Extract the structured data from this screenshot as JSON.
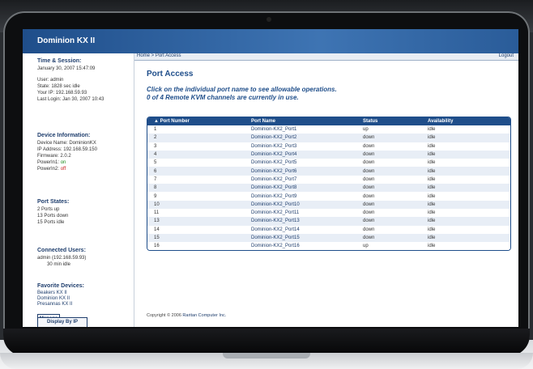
{
  "app": {
    "title": "Dominion KX II",
    "breadcrumb": "Home > Port Access",
    "logout_label": "Logout"
  },
  "sidebar": {
    "time_session": {
      "title": "Time & Session:",
      "datetime": "January 30, 2007 15:47:09",
      "user": "User: admin",
      "state": "State: 1828 sec idle",
      "your_ip": "Your IP: 192.168.59.93",
      "last_login": "Last Login: Jan 30, 2007 10:43"
    },
    "device_info": {
      "title": "Device Information:",
      "device_name": "Device Name: DominionKX",
      "ip_address": "IP Address: 192.168.59.150",
      "firmware": "Firmware: 2.0.2",
      "power1_label": "PowerIn1:",
      "power1_value": "on",
      "power2_label": "PowerIn2:",
      "power2_value": "off"
    },
    "port_states": {
      "title": "Port States:",
      "up": "2 Ports up",
      "down": "13 Ports down",
      "idle": "15 Ports idle"
    },
    "connected_users": {
      "title": "Connected Users:",
      "user": "admin (192.168.59.93)",
      "idle": "30 min idle"
    },
    "favorite_devices": {
      "title": "Favorite Devices:",
      "items": [
        "Beakers KX II",
        "Dominion KX II",
        "Presannas KX II"
      ],
      "manage_label": "Manage",
      "display_label": "Display By IP"
    }
  },
  "main": {
    "title": "Port Access",
    "instruction_1": "Click on the individual port name to see allowable operations.",
    "instruction_2": "0 of 4 Remote KVM channels are currently in use.",
    "columns": [
      "▲ Port Number",
      "Port Name",
      "Status",
      "Availability"
    ],
    "rows": [
      {
        "num": "1",
        "name": "Dominion-KX2_Port1",
        "status": "up",
        "avail": "idle"
      },
      {
        "num": "2",
        "name": "Dominion-KX2_Port2",
        "status": "down",
        "avail": "idle"
      },
      {
        "num": "3",
        "name": "Dominion-KX2_Port3",
        "status": "down",
        "avail": "idle"
      },
      {
        "num": "4",
        "name": "Dominion-KX2_Port4",
        "status": "down",
        "avail": "idle"
      },
      {
        "num": "5",
        "name": "Dominion-KX2_Port5",
        "status": "down",
        "avail": "idle"
      },
      {
        "num": "6",
        "name": "Dominion-KX2_Port6",
        "status": "down",
        "avail": "idle"
      },
      {
        "num": "7",
        "name": "Dominion-KX2_Port7",
        "status": "down",
        "avail": "idle"
      },
      {
        "num": "8",
        "name": "Dominion-KX2_Port8",
        "status": "down",
        "avail": "idle"
      },
      {
        "num": "9",
        "name": "Dominion-KX2_Port9",
        "status": "down",
        "avail": "idle"
      },
      {
        "num": "10",
        "name": "Dominion-KX2_Port10",
        "status": "down",
        "avail": "idle"
      },
      {
        "num": "11",
        "name": "Dominion-KX2_Port11",
        "status": "down",
        "avail": "idle"
      },
      {
        "num": "13",
        "name": "Dominion-KX2_Port13",
        "status": "down",
        "avail": "idle"
      },
      {
        "num": "14",
        "name": "Dominion-KX2_Port14",
        "status": "down",
        "avail": "idle"
      },
      {
        "num": "15",
        "name": "Dominion-KX2_Port15",
        "status": "down",
        "avail": "idle"
      },
      {
        "num": "16",
        "name": "Dominion-KX2_Port16",
        "status": "up",
        "avail": "idle"
      }
    ],
    "footer_prefix": "Copyright © 2006",
    "footer_company": "Raritan Computer Inc."
  },
  "colors": {
    "brand_blue": "#1f4e8a",
    "status_on": "#1a8a1a",
    "status_off": "#cc2222"
  }
}
